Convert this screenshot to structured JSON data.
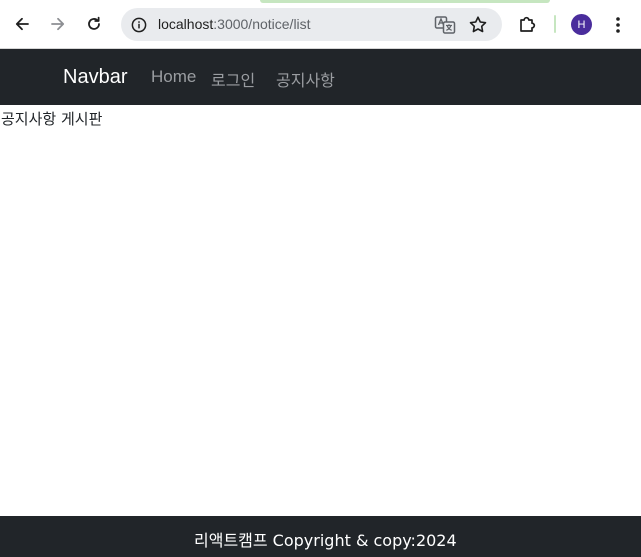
{
  "browser": {
    "url_host": "localhost",
    "url_path": ":3000/notice/list",
    "profile_initial": "H",
    "icons": {
      "back": "arrow-left-icon",
      "forward": "arrow-right-icon",
      "reload": "reload-icon",
      "site_info": "info-icon",
      "translate": "translate-icon",
      "bookmark": "star-icon",
      "extensions": "puzzle-icon",
      "menu": "kebab-menu-icon"
    },
    "colors": {
      "avatar": "#4a2d9c",
      "omnibox": "#e9ebee",
      "accent": "#c6e6c0"
    }
  },
  "navbar": {
    "brand": "Navbar",
    "links": [
      {
        "label": "Home"
      },
      {
        "label": "로그인"
      },
      {
        "label": "공지사항"
      }
    ],
    "colors": {
      "background": "#212529",
      "brand": "#ffffff",
      "link": "#9a9da1"
    }
  },
  "main": {
    "title": "공지사항 게시판"
  },
  "footer": {
    "text": "리액트캠프 Copyright & copy:2024"
  }
}
